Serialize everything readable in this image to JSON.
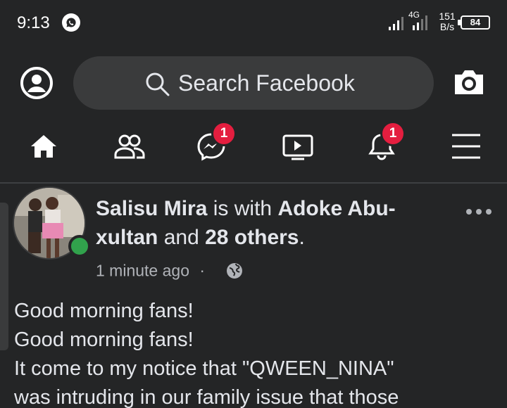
{
  "status_bar": {
    "time": "9:13",
    "network_type": "4G",
    "speed_value": "151",
    "speed_unit": "B/s",
    "battery": "84",
    "notification_icon": "whatsapp-icon"
  },
  "header": {
    "search_placeholder": "Search Facebook"
  },
  "nav": {
    "items": [
      {
        "name": "home",
        "icon": "home-icon"
      },
      {
        "name": "friends",
        "icon": "friends-icon"
      },
      {
        "name": "messenger",
        "icon": "messenger-icon",
        "badge": "1"
      },
      {
        "name": "watch",
        "icon": "video-icon"
      },
      {
        "name": "notifications",
        "icon": "bell-icon",
        "badge": "1"
      },
      {
        "name": "menu",
        "icon": "hamburger-icon"
      }
    ]
  },
  "post": {
    "author": "Salisu Mira",
    "with_text": " is with ",
    "tagged": "Adoke Abu-xultan",
    "and_text": " and ",
    "others": "28 others",
    "period": ".",
    "timestamp": "1 minute ago",
    "separator": "·",
    "privacy_icon": "globe-icon",
    "body_lines": [
      "Good morning fans!",
      "Good morning fans!",
      "It come to my notice that \"QWEEN_NINA\"",
      "was intruding in our family issue that those"
    ]
  },
  "colors": {
    "background": "#242526",
    "search_bg": "#3a3b3c",
    "badge": "#e41e3f",
    "online": "#31a24c",
    "muted_text": "#b0b3b8"
  }
}
